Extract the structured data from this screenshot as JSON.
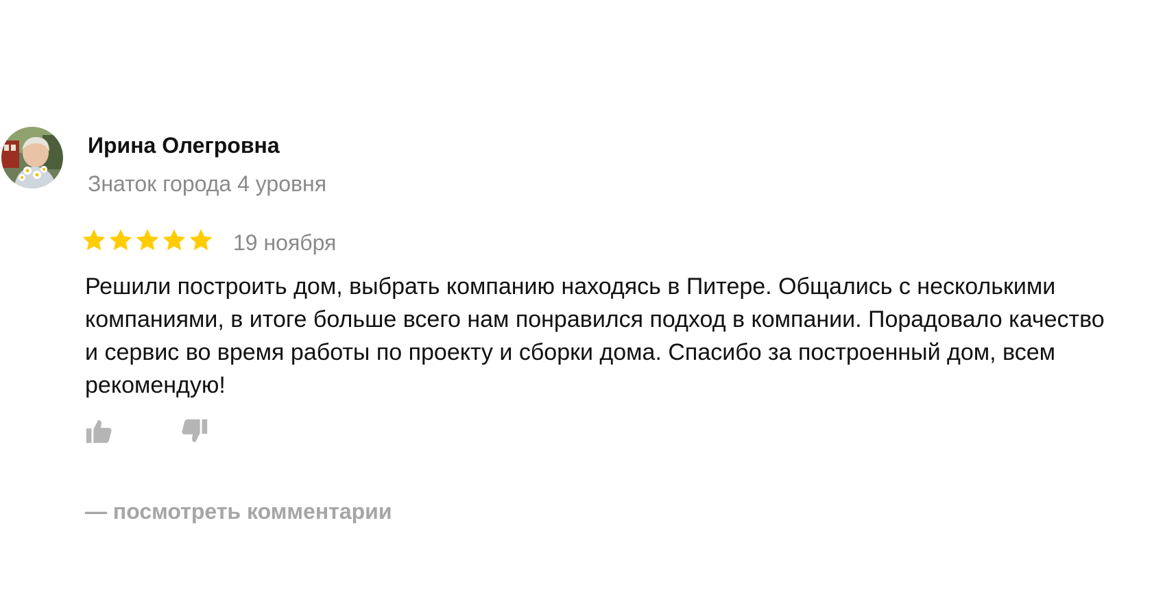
{
  "author": {
    "name": "Ирина Олегровна",
    "level": "Знаток города 4 уровня",
    "avatar_icon": "user-photo-avatar"
  },
  "rating": {
    "value": 5,
    "max": 5,
    "star_color": "#FFCC00"
  },
  "review": {
    "date": "19 ноября",
    "text": "Решили построить дом, выбрать компанию находясь в Питере. Общались с несколькими компаниями, в итоге больше всего нам понравился подход в компании. Порадовало качество и сервис во время работы по проекту и сборки дома. Спасибо за построенный дом, всем рекомендую!"
  },
  "reactions": {
    "like_icon": "thumbs-up-icon",
    "dislike_icon": "thumbs-down-icon",
    "icon_color": "#b5b5b5"
  },
  "comments": {
    "link_label": "— посмотреть комментарии"
  }
}
